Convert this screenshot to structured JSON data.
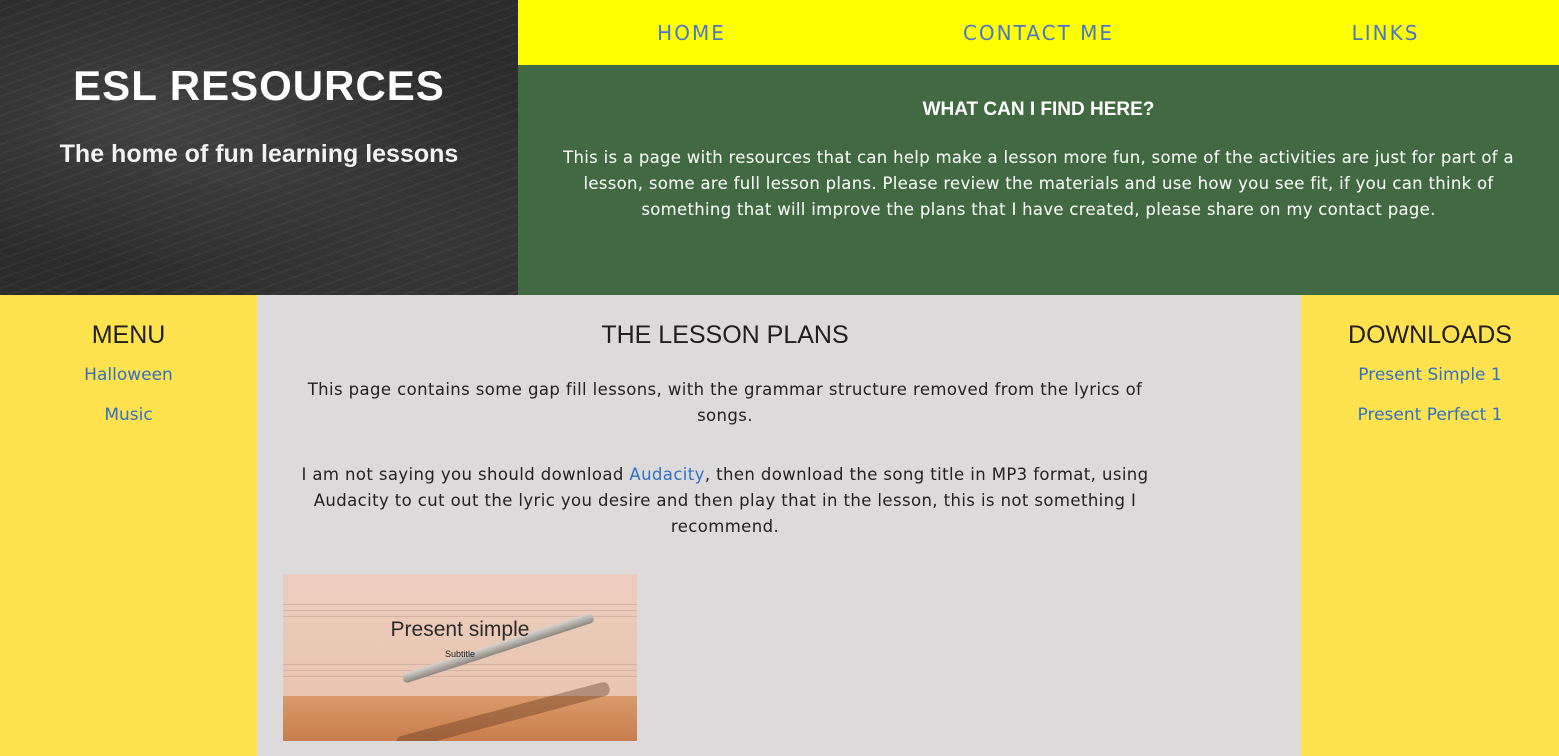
{
  "hero": {
    "title": "ESL RESOURCES",
    "subtitle": "The home of fun learning lessons"
  },
  "nav": {
    "items": [
      {
        "label": "HOME"
      },
      {
        "label": "CONTACT ME"
      },
      {
        "label": "LINKS"
      }
    ]
  },
  "intro": {
    "heading": "WHAT CAN I FIND HERE?",
    "text": "This is a page with resources that can help make a lesson more fun, some of the activities are just for part of a lesson, some are full lesson plans. Please review the materials and use how you see fit, if you can think of something that will improve the plans that I have created, please share on my contact page."
  },
  "menu": {
    "heading": "MENU",
    "items": [
      {
        "label": "Halloween"
      },
      {
        "label": "Music"
      }
    ]
  },
  "main": {
    "heading": "THE LESSON PLANS",
    "paragraph1": "This page contains some gap fill lessons, with the grammar structure removed from the lyrics of songs.",
    "paragraph2_before": "I am not saying you should download ",
    "paragraph2_link": "Audacity",
    "paragraph2_after": ", then download the song title in MP3 format, using Audacity to cut out the lyric you desire and then play that in the lesson, this is not something I recommend.",
    "thumbnail": {
      "title": "Present simple",
      "subtitle": "Subtitle"
    }
  },
  "downloads": {
    "heading": "DOWNLOADS",
    "items": [
      {
        "label": "Present Simple 1"
      },
      {
        "label": "Present Perfect 1"
      }
    ]
  },
  "colors": {
    "nav_bg": "#ffff00",
    "nav_link": "#4a78c8",
    "intro_bg": "#416a42",
    "side_bg": "#ffe24d",
    "main_bg": "#dcdadb",
    "link": "#2f72c5"
  }
}
